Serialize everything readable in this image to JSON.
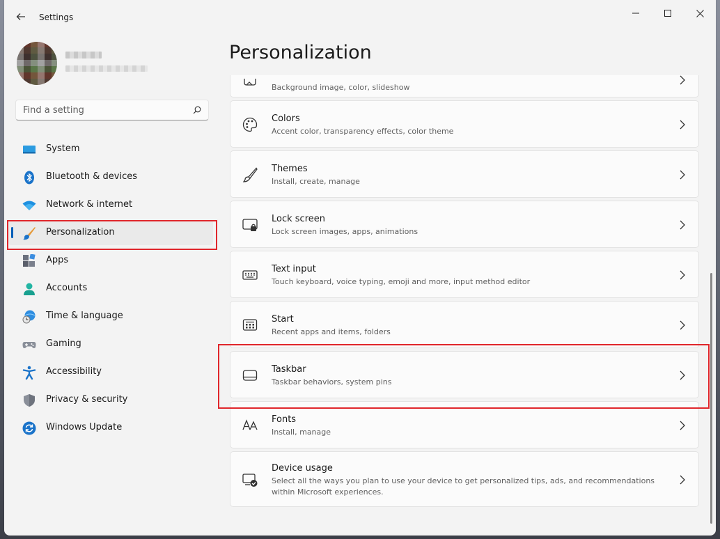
{
  "window": {
    "title": "Settings"
  },
  "search": {
    "placeholder": "Find a setting"
  },
  "nav": {
    "items": [
      {
        "label": "System",
        "icon": "system-icon"
      },
      {
        "label": "Bluetooth & devices",
        "icon": "bluetooth-icon"
      },
      {
        "label": "Network & internet",
        "icon": "wifi-icon"
      },
      {
        "label": "Personalization",
        "icon": "brush-icon",
        "selected": true
      },
      {
        "label": "Apps",
        "icon": "apps-icon"
      },
      {
        "label": "Accounts",
        "icon": "accounts-icon"
      },
      {
        "label": "Time & language",
        "icon": "time-language-icon"
      },
      {
        "label": "Gaming",
        "icon": "gaming-icon"
      },
      {
        "label": "Accessibility",
        "icon": "accessibility-icon"
      },
      {
        "label": "Privacy & security",
        "icon": "shield-icon"
      },
      {
        "label": "Windows Update",
        "icon": "update-icon"
      }
    ]
  },
  "page": {
    "title": "Personalization"
  },
  "cards": [
    {
      "title": "",
      "desc": "Background image, color, slideshow",
      "icon": "background-icon"
    },
    {
      "title": "Colors",
      "desc": "Accent color, transparency effects, color theme",
      "icon": "palette-icon"
    },
    {
      "title": "Themes",
      "desc": "Install, create, manage",
      "icon": "themes-brush-icon"
    },
    {
      "title": "Lock screen",
      "desc": "Lock screen images, apps, animations",
      "icon": "lock-screen-icon"
    },
    {
      "title": "Text input",
      "desc": "Touch keyboard, voice typing, emoji and more, input method editor",
      "icon": "keyboard-icon"
    },
    {
      "title": "Start",
      "desc": "Recent apps and items, folders",
      "icon": "start-icon"
    },
    {
      "title": "Taskbar",
      "desc": "Taskbar behaviors, system pins",
      "icon": "taskbar-icon"
    },
    {
      "title": "Fonts",
      "desc": "Install, manage",
      "icon": "fonts-icon"
    },
    {
      "title": "Device usage",
      "desc": "Select all the ways you plan to use your device to get personalized tips, ads, and recommendations within Microsoft experiences.",
      "icon": "device-usage-icon"
    }
  ],
  "colors": {
    "accent": "#005fb8",
    "highlight": "#e0262b"
  }
}
